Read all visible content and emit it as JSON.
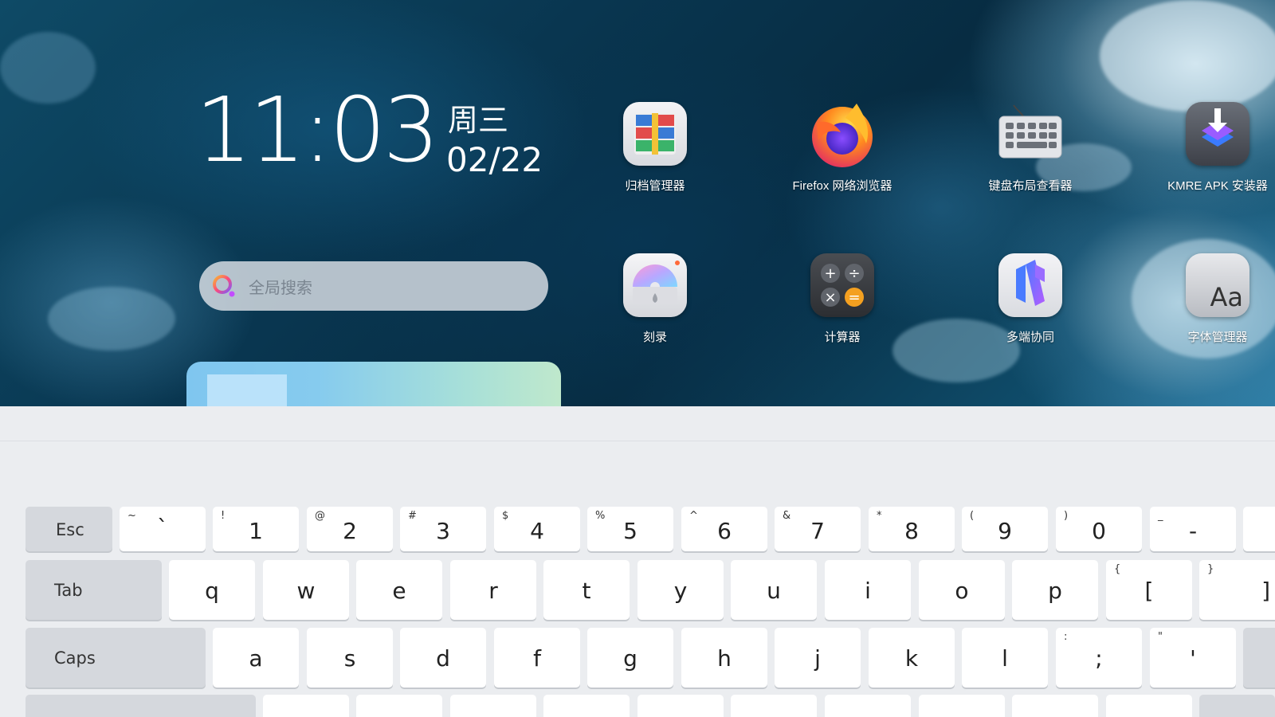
{
  "clock": {
    "time": "11:03",
    "weekday": "周三",
    "date": "02/22"
  },
  "search": {
    "placeholder": "全局搜索"
  },
  "apps": [
    {
      "label": "归档管理器",
      "icon": "archive-manager-icon"
    },
    {
      "label": "Firefox 网络浏览器",
      "icon": "firefox-icon"
    },
    {
      "label": "键盘布局查看器",
      "icon": "keyboard-layout-icon"
    },
    {
      "label": "KMRE APK 安装器",
      "icon": "kmre-apk-icon"
    },
    {
      "label": "刻录",
      "icon": "burner-icon"
    },
    {
      "label": "计算器",
      "icon": "calculator-icon"
    },
    {
      "label": "多端协同",
      "icon": "multi-device-icon"
    },
    {
      "label": "字体管理器",
      "icon": "font-manager-icon"
    }
  ],
  "font_icon_text": "Aa",
  "keyboard": {
    "row1": [
      {
        "main": "Esc",
        "fn": true
      },
      {
        "main": "`",
        "shift": "~"
      },
      {
        "main": "1",
        "shift": "!"
      },
      {
        "main": "2",
        "shift": "@"
      },
      {
        "main": "3",
        "shift": "#"
      },
      {
        "main": "4",
        "shift": "$"
      },
      {
        "main": "5",
        "shift": "%"
      },
      {
        "main": "6",
        "shift": "^"
      },
      {
        "main": "7",
        "shift": "&"
      },
      {
        "main": "8",
        "shift": "*"
      },
      {
        "main": "9",
        "shift": "("
      },
      {
        "main": "0",
        "shift": ")"
      },
      {
        "main": "-",
        "shift": "_"
      }
    ],
    "row2": [
      {
        "main": "Tab",
        "fn": true
      },
      {
        "main": "q"
      },
      {
        "main": "w"
      },
      {
        "main": "e"
      },
      {
        "main": "r"
      },
      {
        "main": "t"
      },
      {
        "main": "y"
      },
      {
        "main": "u"
      },
      {
        "main": "i"
      },
      {
        "main": "o"
      },
      {
        "main": "p"
      },
      {
        "main": "[",
        "shift": "{"
      },
      {
        "main": "]",
        "shift": "}"
      }
    ],
    "row3": [
      {
        "main": "Caps",
        "fn": true
      },
      {
        "main": "a"
      },
      {
        "main": "s"
      },
      {
        "main": "d"
      },
      {
        "main": "f"
      },
      {
        "main": "g"
      },
      {
        "main": "h"
      },
      {
        "main": "j"
      },
      {
        "main": "k"
      },
      {
        "main": "l"
      },
      {
        "main": ";",
        "shift": ":"
      },
      {
        "main": "'",
        "shift": "\""
      }
    ]
  },
  "colors": {
    "calc_accent": "#f4a020",
    "keyboard_bg": "#ebedf0",
    "fn_key_bg": "#d5d8dd"
  }
}
